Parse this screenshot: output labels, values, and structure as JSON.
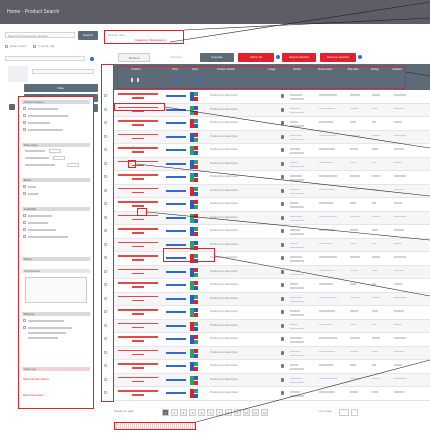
{
  "topbar": {
    "title": "Home · Product Search"
  },
  "left": {
    "search_placeholder": "Search by keyword or product",
    "go_label": "Search",
    "options": [
      "Exact match",
      "In stock only"
    ],
    "buttons": [
      "Filter",
      "Save search criteria",
      "Clear all filters"
    ],
    "sections": [
      "Product category",
      "Price range",
      "Brand",
      "Availability",
      "Rating",
      "Specifications",
      "Shipping",
      "Seller type"
    ],
    "red_links": [
      "Show 24 more options",
      "Reset this section"
    ]
  },
  "main": {
    "path": {
      "label": "Results path",
      "value": "Category / Subcategory"
    },
    "tabs": [
      "All items",
      "Favorites",
      "Compare",
      "Add to list",
      "Export selected",
      "Remove selected"
    ],
    "header": [
      "Product",
      "Price",
      "Color",
      "Product Details",
      "Image",
      "Vendor",
      "Stock status",
      "Ship date",
      "Rating",
      "Updated"
    ],
    "row_detail": "Product item description",
    "rows": 23,
    "pager": {
      "pages": [
        "1",
        "2",
        "3",
        "4",
        "5",
        "6",
        "7",
        "8",
        "9",
        "10",
        "11",
        "12"
      ],
      "current": "1",
      "label_left": "Results per page",
      "label_right": "Go to page"
    }
  },
  "colors": {
    "accent": "#e0222f",
    "header": "#5d6a78",
    "topbar": "#5d5d66",
    "link": "#2f6ad0"
  }
}
